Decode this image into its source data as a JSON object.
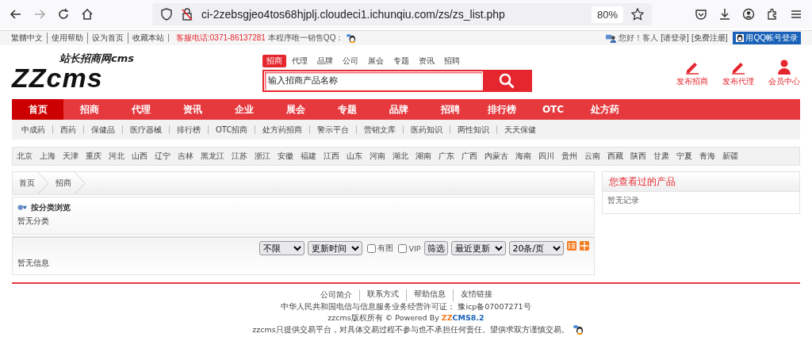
{
  "browser": {
    "url": "ci-2zebsgjeo4tos68hjplj.cloudeci1.ichunqiu.com/zs/zs_list.php",
    "zoom": "80%"
  },
  "topbar": {
    "links": [
      "繁體中文",
      "使用帮助",
      "设为首页",
      "收藏本站"
    ],
    "hotline": "客服电话:0371-86137281",
    "sales_qq": "本程序唯一销售QQ：",
    "greeting": "您好！客人",
    "login": "[请登录]",
    "register": "[免费注册]",
    "qq_login": "用QQ帐号登录"
  },
  "header": {
    "logo_main": "ZZcms",
    "logo_sub": "站长招商网cms",
    "search_tabs": [
      {
        "label": "招商",
        "selected": true
      },
      {
        "label": "代理",
        "selected": false
      },
      {
        "label": "品牌",
        "selected": false
      },
      {
        "label": "公司",
        "selected": false
      },
      {
        "label": "展会",
        "selected": false
      },
      {
        "label": "专题",
        "selected": false
      },
      {
        "label": "资讯",
        "selected": false
      },
      {
        "label": "招聘",
        "selected": false
      }
    ],
    "search_placeholder": "输入招商产品名称",
    "actions": [
      {
        "label": "发布招商",
        "kind": "pen"
      },
      {
        "label": "发布代理",
        "kind": "pen"
      },
      {
        "label": "会员中心",
        "kind": "user"
      }
    ]
  },
  "nav": [
    {
      "label": "首页",
      "selected": true
    },
    {
      "label": "招商",
      "selected": false
    },
    {
      "label": "代理",
      "selected": false
    },
    {
      "label": "资讯",
      "selected": false
    },
    {
      "label": "企业",
      "selected": false
    },
    {
      "label": "展会",
      "selected": false
    },
    {
      "label": "专题",
      "selected": false
    },
    {
      "label": "品牌",
      "selected": false
    },
    {
      "label": "招聘",
      "selected": false
    },
    {
      "label": "排行榜",
      "selected": false
    },
    {
      "label": "OTC",
      "selected": false
    },
    {
      "label": "处方药",
      "selected": false
    }
  ],
  "subnav": [
    "中成药",
    "西药",
    "保健品",
    "医疗器械",
    "排行榜",
    "OTC招商",
    "处方药招商",
    "警示平台",
    "营销文库",
    "医药知识",
    "两性知识",
    "天天保健"
  ],
  "cities": [
    "北京",
    "上海",
    "天津",
    "重庆",
    "河北",
    "山西",
    "辽宁",
    "吉林",
    "黑龙江",
    "江苏",
    "浙江",
    "安徽",
    "福建",
    "江西",
    "山东",
    "河南",
    "湖北",
    "湖南",
    "广东",
    "广西",
    "内蒙古",
    "海南",
    "四川",
    "贵州",
    "云南",
    "西藏",
    "陕西",
    "甘肃",
    "宁夏",
    "青海",
    "新疆"
  ],
  "breadcrumb": [
    "首页",
    "招商"
  ],
  "category": {
    "title": "按分类浏览",
    "empty": "暂无分类"
  },
  "filters": {
    "region": "不限",
    "sort_field": "更新时间",
    "checkboxes": [
      {
        "label": "有图",
        "checked": false
      },
      {
        "label": "VIP",
        "checked": false
      }
    ],
    "button": "筛选",
    "order": "最近更新",
    "per_page": "20条/页"
  },
  "list_empty": "暂无信息",
  "sidebar": {
    "title": "您查看过的产品",
    "empty": "暂无记录"
  },
  "footer": {
    "links": [
      "公司简介",
      "联系方式",
      "帮助信息",
      "友情链接"
    ],
    "license": "中华人民共和国电信与信息服务业务经营许可证： 豫icp备07007271号",
    "copyright": "zzcms版权所有 © Powered By ",
    "brand_a": "ZZ",
    "brand_b": "CMS8.2",
    "disclaimer": "zzcms只提供交易平台，对具体交易过程不参与也不承担任何责任。望供求双方谨慎交易。"
  }
}
